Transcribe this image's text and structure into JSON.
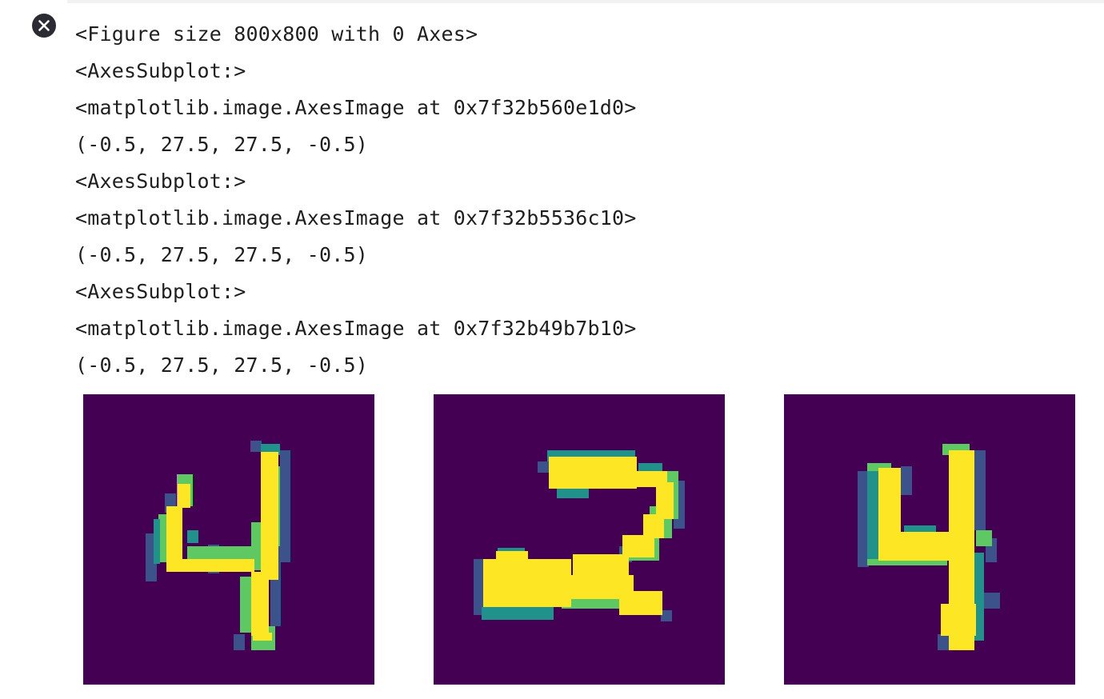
{
  "output": {
    "lines": [
      "<Figure size 800x800 with 0 Axes>",
      "<AxesSubplot:>",
      "<matplotlib.image.AxesImage at 0x7f32b560e1d0>",
      "(-0.5, 27.5, 27.5, -0.5)",
      "<AxesSubplot:>",
      "<matplotlib.image.AxesImage at 0x7f32b5536c10>",
      "(-0.5, 27.5, 27.5, -0.5)",
      "<AxesSubplot:>",
      "<matplotlib.image.AxesImage at 0x7f32b49b7b10>",
      "(-0.5, 27.5, 27.5, -0.5)"
    ]
  },
  "icons": {
    "clear_output": "close-circle-icon"
  },
  "figure": {
    "colormap": "viridis",
    "background_color": "#440154",
    "images": [
      {
        "digit": "4"
      },
      {
        "digit": "2"
      },
      {
        "digit": "4"
      }
    ]
  }
}
